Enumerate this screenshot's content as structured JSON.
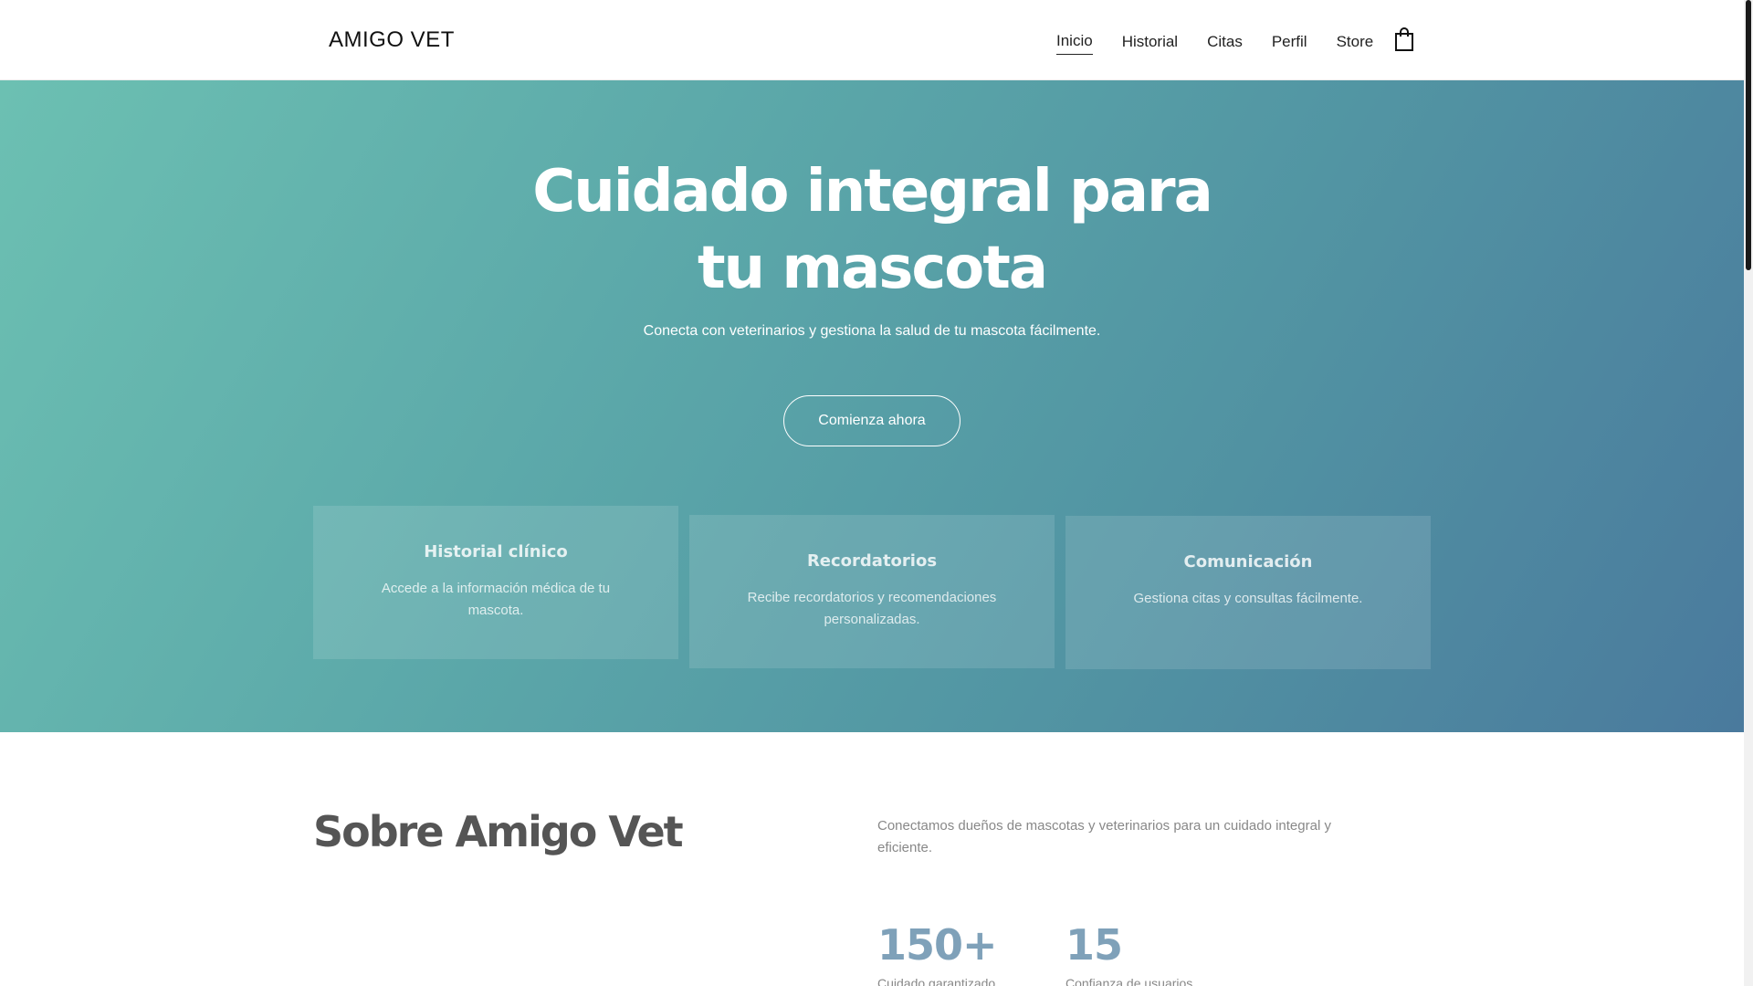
{
  "header": {
    "brand": "AMIGO VET",
    "nav": [
      {
        "label": "Inicio",
        "active": true
      },
      {
        "label": "Historial",
        "active": false
      },
      {
        "label": "Citas",
        "active": false
      },
      {
        "label": "Perfil",
        "active": false
      },
      {
        "label": "Store",
        "active": false
      }
    ],
    "cart_icon": "shopping-bag-icon"
  },
  "hero": {
    "title": "Cuidado integral para tu mascota",
    "subtitle": "Conecta con veterinarios y gestiona la salud de tu mascota fácilmente.",
    "cta_label": "Comienza ahora",
    "gradient_colors": [
      "#6cc0b2",
      "#5295a3",
      "#4a7a9d"
    ],
    "cards": [
      {
        "title": "Historial clínico",
        "text": "Accede a la información médica de tu mascota."
      },
      {
        "title": "Recordatorios",
        "text": "Recibe recordatorios y recomendaciones personalizadas."
      },
      {
        "title": "Comunicación",
        "text": "Gestiona citas y consultas fácilmente."
      }
    ]
  },
  "about": {
    "title": "Sobre Amigo Vet",
    "text": "Conectamos dueños de mascotas y veterinarios para un cuidado integral y eficiente.",
    "stats": [
      {
        "value": "150+",
        "label": "Cuidado garantizado"
      },
      {
        "value": "15",
        "label": "Confianza de usuarios"
      }
    ],
    "stat_color": "#7fa1b9"
  }
}
